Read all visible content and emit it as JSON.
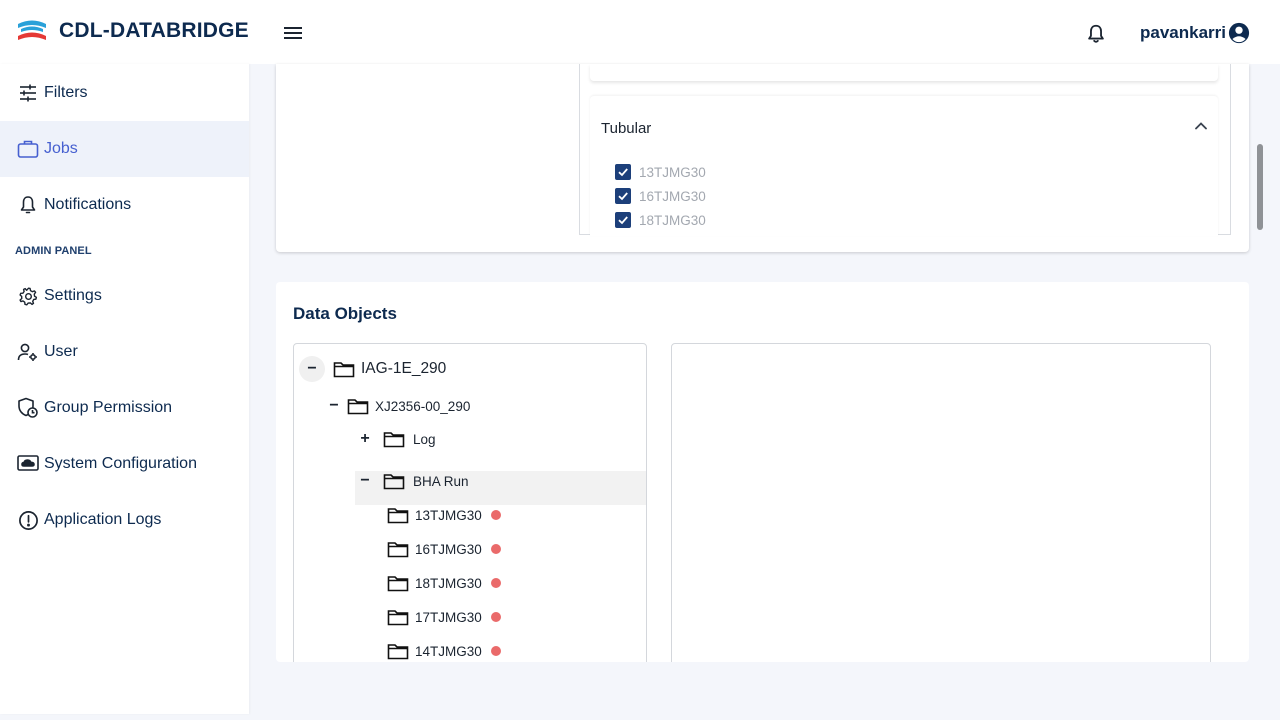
{
  "app": {
    "title": "CDL-DATABRIDGE",
    "user_name": "pavankarri",
    "logo_colors": {
      "primary": "#2aa1d9",
      "secondary": "#e53935"
    }
  },
  "sidebar": {
    "items": [
      {
        "label": "Filters",
        "icon": "sliders-icon"
      },
      {
        "label": "Jobs",
        "icon": "briefcase-icon",
        "active": true
      },
      {
        "label": "Notifications",
        "icon": "bell-icon"
      }
    ],
    "admin_label": "ADMIN PANEL",
    "admin_items": [
      {
        "label": "Settings",
        "icon": "gear-icon"
      },
      {
        "label": "User",
        "icon": "user-settings-icon"
      },
      {
        "label": "Group Permission",
        "icon": "shield-clock-icon"
      },
      {
        "label": "System Configuration",
        "icon": "cloud-monitor-icon"
      },
      {
        "label": "Application Logs",
        "icon": "alert-circle-icon"
      }
    ]
  },
  "filters": {
    "section_title": "Tubular",
    "options": [
      {
        "label": "13TJMG30",
        "checked": true
      },
      {
        "label": "16TJMG30",
        "checked": true
      },
      {
        "label": "18TJMG30",
        "checked": true
      }
    ]
  },
  "data_objects": {
    "title": "Data Objects",
    "tree": {
      "root": "IAG-1E_290",
      "child": "XJ2356-00_290",
      "log": "Log",
      "bha_run": "BHA Run",
      "bha_children": [
        "13TJMG30",
        "16TJMG30",
        "18TJMG30",
        "17TJMG30",
        "14TJMG30"
      ]
    }
  },
  "colors": {
    "accent": "#4660d0",
    "navy": "#0d2a4f",
    "checkbox": "#1c3f7a",
    "status_dot": "#ea6a6a"
  }
}
